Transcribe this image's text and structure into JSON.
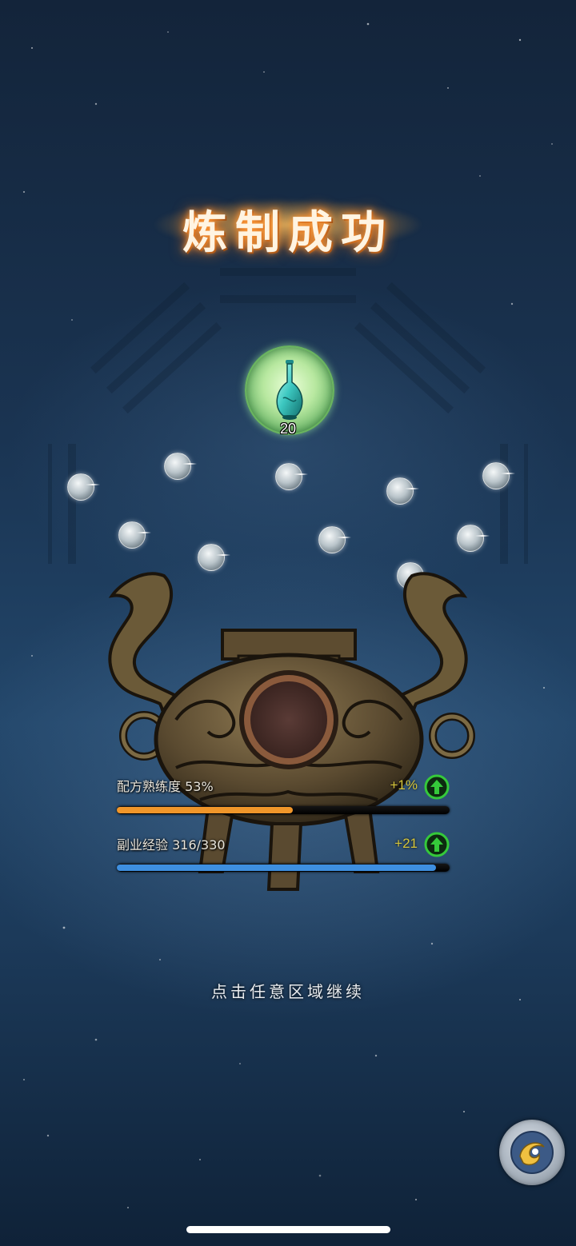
{
  "result": {
    "title": "炼制成功",
    "item": {
      "icon": "jade-vase-icon",
      "count": "20"
    }
  },
  "stats": [
    {
      "label": "配方熟练度 53%",
      "gain": "+1%",
      "progress": 0.53,
      "bar_color": "#f0962a"
    },
    {
      "label": "副业经验 316/330",
      "gain": "+21",
      "progress": 0.958,
      "bar_color": "#3e8fe0"
    }
  ],
  "hint": "点击任意区域继续",
  "colors": {
    "gain_text": "#d6c63a",
    "up_icon": "#35c93a",
    "title_glow": "#ff9b3a"
  },
  "floating_button": {
    "icon": "swirl-spirit-icon"
  }
}
